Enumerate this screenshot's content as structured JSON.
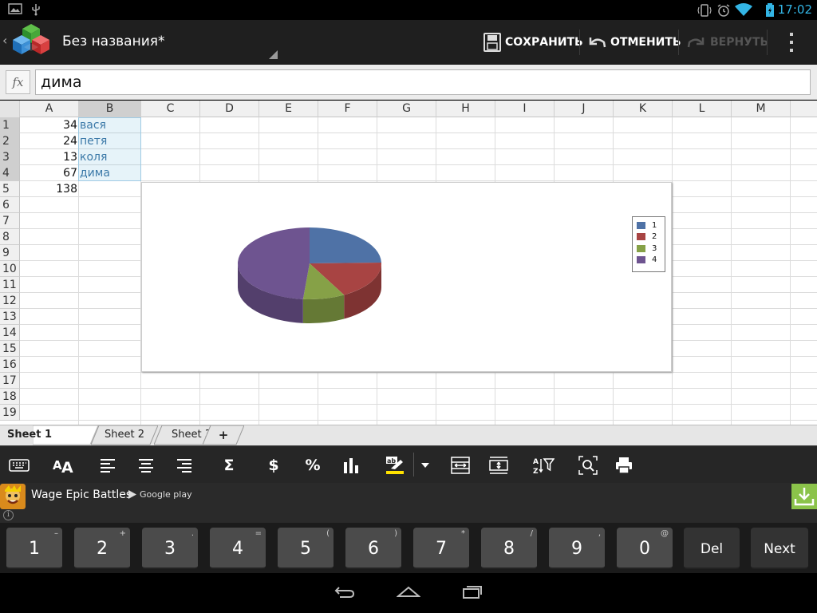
{
  "status": {
    "time": "17:02"
  },
  "actionbar": {
    "title": "Без названия*",
    "save_label": "СОХРАНИТЬ",
    "undo_label": "ОТМЕНИТЬ",
    "redo_label": "ВЕРНУТЬ"
  },
  "formula": {
    "fx": "fx",
    "value": "дима"
  },
  "sheet": {
    "columns": [
      "A",
      "B",
      "C",
      "D",
      "E",
      "F",
      "G",
      "H",
      "I",
      "J",
      "K",
      "L",
      "M"
    ],
    "rows": [
      "1",
      "2",
      "3",
      "4",
      "5",
      "6",
      "7",
      "8",
      "9",
      "10",
      "11",
      "12",
      "13",
      "14",
      "15",
      "16",
      "17",
      "18",
      "19"
    ],
    "cells": {
      "A1": "34",
      "B1": "вася",
      "A2": "24",
      "B2": "петя",
      "A3": "13",
      "B3": "коля",
      "A4": "67",
      "B4": "дима",
      "A5": "138"
    }
  },
  "chart_data": {
    "type": "pie",
    "categories": [
      "1",
      "2",
      "3",
      "4"
    ],
    "values": [
      34,
      24,
      13,
      67
    ],
    "colors": [
      "#4f72a6",
      "#a84443",
      "#86a147",
      "#6e5490"
    ],
    "legend": "right"
  },
  "tabs": [
    {
      "label": "Sheet 1",
      "active": true
    },
    {
      "label": "Sheet 2",
      "active": false
    },
    {
      "label": "Sheet 3",
      "active": false
    },
    {
      "label": "+",
      "active": false
    }
  ],
  "toolbar": {
    "currency": "$",
    "percent": "%",
    "sum": "Σ"
  },
  "ad": {
    "title": "Wage Epic Battles",
    "store": "Google play"
  },
  "keyboard": {
    "keys": [
      {
        "label": "1",
        "sup": "–"
      },
      {
        "label": "2",
        "sup": "+"
      },
      {
        "label": "3",
        "sup": "."
      },
      {
        "label": "4",
        "sup": "="
      },
      {
        "label": "5",
        "sup": "("
      },
      {
        "label": "6",
        "sup": ")"
      },
      {
        "label": "7",
        "sup": "*"
      },
      {
        "label": "8",
        "sup": "/"
      },
      {
        "label": "9",
        "sup": ","
      },
      {
        "label": "0",
        "sup": "@"
      }
    ],
    "del": "Del",
    "next": "Next"
  }
}
